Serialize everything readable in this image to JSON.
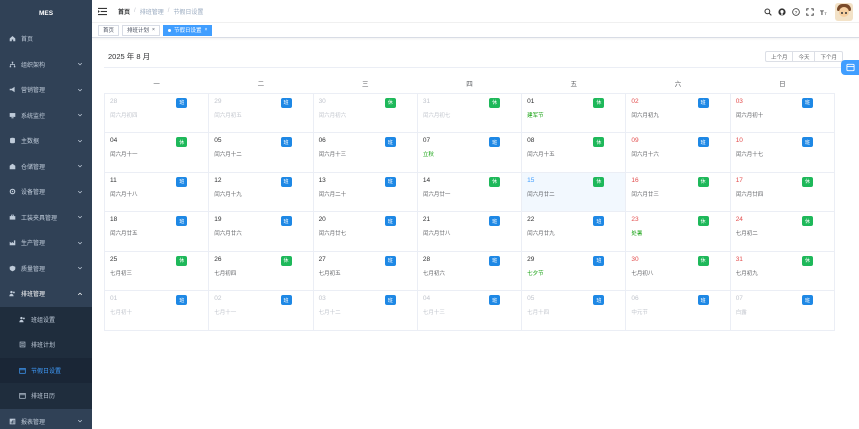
{
  "app": {
    "title": "MES"
  },
  "sidebar": {
    "items": [
      {
        "label": "首页",
        "icon": "home-icon",
        "arrow": false
      },
      {
        "label": "组织架构",
        "icon": "org-icon",
        "arrow": true
      },
      {
        "label": "营销管理",
        "icon": "marketing-icon",
        "arrow": true
      },
      {
        "label": "系统监控",
        "icon": "monitor-icon",
        "arrow": true
      },
      {
        "label": "主数据",
        "icon": "database-icon",
        "arrow": true
      },
      {
        "label": "仓储管理",
        "icon": "warehouse-icon",
        "arrow": true
      },
      {
        "label": "设备管理",
        "icon": "equipment-icon",
        "arrow": true
      },
      {
        "label": "工装夹具管理",
        "icon": "fixture-icon",
        "arrow": true
      },
      {
        "label": "生产管理",
        "icon": "production-icon",
        "arrow": true
      },
      {
        "label": "质量管理",
        "icon": "quality-icon",
        "arrow": true
      },
      {
        "label": "排班管理",
        "icon": "schedule-icon",
        "arrow": true
      }
    ],
    "submenu": [
      {
        "label": "班组设置",
        "icon": "team-icon",
        "active": false
      },
      {
        "label": "排班计划",
        "icon": "plan-icon",
        "active": false
      },
      {
        "label": "节假日设置",
        "icon": "holiday-icon",
        "active": true
      },
      {
        "label": "排班日历",
        "icon": "calendar-icon",
        "active": false
      }
    ],
    "bottom": {
      "label": "报表管理",
      "icon": "report-icon"
    }
  },
  "navbar": {
    "breadcrumb": [
      "首页",
      "排班管理",
      "节假日设置"
    ],
    "icons": [
      "search-icon",
      "github-icon",
      "help-icon",
      "fullscreen-icon",
      "font-size-icon"
    ]
  },
  "tags": [
    {
      "label": "首页",
      "active": false,
      "closable": false
    },
    {
      "label": "排班计划",
      "active": false,
      "closable": true
    },
    {
      "label": "节假日设置",
      "active": true,
      "closable": true
    }
  ],
  "calendar": {
    "title": "2025 年 8 月",
    "buttons": {
      "prev": "上个月",
      "today": "今天",
      "next": "下个月"
    },
    "weekdays": [
      "一",
      "二",
      "三",
      "四",
      "五",
      "六",
      "日"
    ],
    "weeks": [
      [
        {
          "d": "28",
          "l": "闰六月初四",
          "b": "班",
          "t": "gray"
        },
        {
          "d": "29",
          "l": "闰六月初五",
          "b": "班",
          "t": "gray"
        },
        {
          "d": "30",
          "l": "闰六月初六",
          "b": "休",
          "t": "gray"
        },
        {
          "d": "31",
          "l": "闰六月初七",
          "b": "休",
          "t": "gray"
        },
        {
          "d": "01",
          "l": "建军节",
          "b": "休",
          "t": "holiday"
        },
        {
          "d": "02",
          "l": "闰六月初九",
          "b": "班",
          "t": "weekend"
        },
        {
          "d": "03",
          "l": "闰六月初十",
          "b": "班",
          "t": "weekend"
        }
      ],
      [
        {
          "d": "04",
          "l": "闰六月十一",
          "b": "休",
          "t": ""
        },
        {
          "d": "05",
          "l": "闰六月十二",
          "b": "班",
          "t": ""
        },
        {
          "d": "06",
          "l": "闰六月十三",
          "b": "班",
          "t": ""
        },
        {
          "d": "07",
          "l": "立秋",
          "b": "班",
          "t": "holiday"
        },
        {
          "d": "08",
          "l": "闰六月十五",
          "b": "休",
          "t": ""
        },
        {
          "d": "09",
          "l": "闰六月十六",
          "b": "班",
          "t": "weekend"
        },
        {
          "d": "10",
          "l": "闰六月十七",
          "b": "班",
          "t": "weekend"
        }
      ],
      [
        {
          "d": "11",
          "l": "闰六月十八",
          "b": "班",
          "t": ""
        },
        {
          "d": "12",
          "l": "闰六月十九",
          "b": "班",
          "t": ""
        },
        {
          "d": "13",
          "l": "闰六月二十",
          "b": "班",
          "t": ""
        },
        {
          "d": "14",
          "l": "闰六月廿一",
          "b": "休",
          "t": ""
        },
        {
          "d": "15",
          "l": "闰六月廿二",
          "b": "休",
          "t": "today"
        },
        {
          "d": "16",
          "l": "闰六月廿三",
          "b": "休",
          "t": "weekend"
        },
        {
          "d": "17",
          "l": "闰六月廿四",
          "b": "休",
          "t": "weekend"
        }
      ],
      [
        {
          "d": "18",
          "l": "闰六月廿五",
          "b": "班",
          "t": ""
        },
        {
          "d": "19",
          "l": "闰六月廿六",
          "b": "班",
          "t": ""
        },
        {
          "d": "20",
          "l": "闰六月廿七",
          "b": "班",
          "t": ""
        },
        {
          "d": "21",
          "l": "闰六月廿八",
          "b": "班",
          "t": ""
        },
        {
          "d": "22",
          "l": "闰六月廿九",
          "b": "班",
          "t": ""
        },
        {
          "d": "23",
          "l": "处暑",
          "b": "休",
          "t": "weekend holiday"
        },
        {
          "d": "24",
          "l": "七月初二",
          "b": "休",
          "t": "weekend"
        }
      ],
      [
        {
          "d": "25",
          "l": "七月初三",
          "b": "休",
          "t": ""
        },
        {
          "d": "26",
          "l": "七月初四",
          "b": "休",
          "t": ""
        },
        {
          "d": "27",
          "l": "七月初五",
          "b": "班",
          "t": ""
        },
        {
          "d": "28",
          "l": "七月初六",
          "b": "班",
          "t": ""
        },
        {
          "d": "29",
          "l": "七夕节",
          "b": "班",
          "t": "holiday"
        },
        {
          "d": "30",
          "l": "七月初八",
          "b": "休",
          "t": "weekend"
        },
        {
          "d": "31",
          "l": "七月初九",
          "b": "休",
          "t": "weekend"
        }
      ],
      [
        {
          "d": "01",
          "l": "七月初十",
          "b": "班",
          "t": "gray"
        },
        {
          "d": "02",
          "l": "七月十一",
          "b": "班",
          "t": "gray"
        },
        {
          "d": "03",
          "l": "七月十二",
          "b": "班",
          "t": "gray"
        },
        {
          "d": "04",
          "l": "七月十三",
          "b": "班",
          "t": "gray"
        },
        {
          "d": "05",
          "l": "七月十四",
          "b": "班",
          "t": "gray"
        },
        {
          "d": "06",
          "l": "中元节",
          "b": "班",
          "t": "gray"
        },
        {
          "d": "07",
          "l": "白露",
          "b": "班",
          "t": "gray"
        }
      ]
    ]
  },
  "colors": {
    "sidebar": "#304156",
    "accent": "#409eff",
    "work": "#1e88e5",
    "rest": "#1eb85a",
    "weekend": "#e34d4d"
  }
}
